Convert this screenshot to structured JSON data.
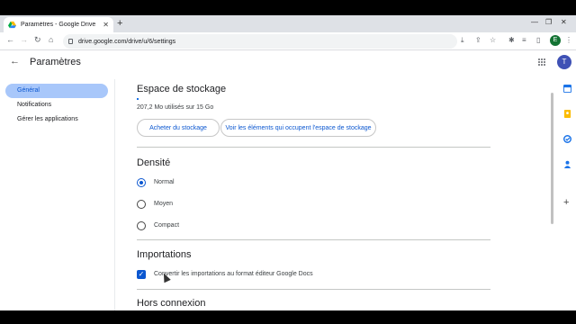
{
  "browser": {
    "tab_title": "Paramètres - Google Drive",
    "url": "drive.google.com/drive/u/6/settings",
    "profile_initial": "E"
  },
  "header": {
    "title": "Paramètres",
    "account_initial": "T"
  },
  "sidebar": {
    "items": [
      {
        "label": "Général",
        "active": true
      },
      {
        "label": "Notifications",
        "active": false
      },
      {
        "label": "Gérer les applications",
        "active": false
      }
    ]
  },
  "storage": {
    "heading": "Espace de stockage",
    "usage_text": "207,2 Mo utilisés sur 15 Go",
    "buy_label": "Acheter du stockage",
    "view_label": "Voir les éléments qui occupent l'espace de stockage"
  },
  "density": {
    "heading": "Densité",
    "options": [
      {
        "label": "Normal",
        "selected": true
      },
      {
        "label": "Moyen",
        "selected": false
      },
      {
        "label": "Compact",
        "selected": false
      }
    ]
  },
  "imports": {
    "heading": "Importations",
    "convert_label": "Convertir les importations au format éditeur Google Docs",
    "convert_checked": true
  },
  "offline": {
    "heading": "Hors connexion"
  },
  "colors": {
    "accent": "#0b57d0",
    "active_nav": "#a8c7fa"
  }
}
